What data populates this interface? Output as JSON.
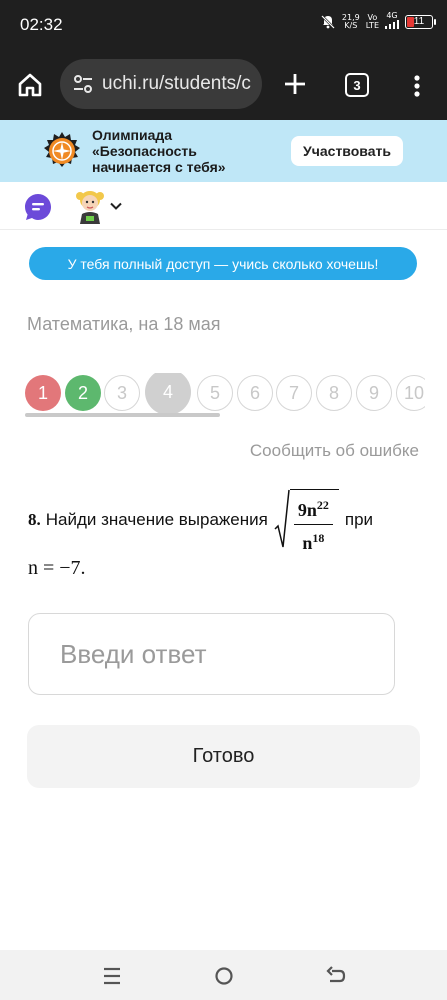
{
  "status_bar": {
    "time": "02:32",
    "net_speed_top": "21,9",
    "net_speed_bottom": "K/S",
    "volte_top": "Vo",
    "volte_bottom": "LTE",
    "signal_label": "4G",
    "battery": "11"
  },
  "browser": {
    "url": "uchi.ru/students/c",
    "tab_count": "3"
  },
  "promo": {
    "text": "Олимпиада «Безопасность начинается с тебя»",
    "button": "Участвовать"
  },
  "access_banner": "У тебя полный доступ — учись сколько хочешь!",
  "lesson_title": "Математика, на 18 мая",
  "progress": {
    "items": [
      {
        "label": "1",
        "state": "wrong"
      },
      {
        "label": "2",
        "state": "correct"
      },
      {
        "label": "3",
        "state": "pending"
      },
      {
        "label": "4",
        "state": "current"
      },
      {
        "label": "5",
        "state": "pending"
      },
      {
        "label": "6",
        "state": "pending"
      },
      {
        "label": "7",
        "state": "pending"
      },
      {
        "label": "8",
        "state": "pending"
      },
      {
        "label": "9",
        "state": "pending"
      },
      {
        "label": "10",
        "state": "pending"
      }
    ]
  },
  "report_link": "Сообщить об ошибке",
  "task": {
    "number": "8.",
    "text_before": "Найди значение выражения",
    "numerator_base": "9n",
    "numerator_exp": "22",
    "denominator_base": "n",
    "denominator_exp": "18",
    "text_after": "при",
    "condition": "n = −7."
  },
  "answer": {
    "placeholder": "Введи ответ",
    "value": ""
  },
  "done_button": "Готово",
  "colors": {
    "wrong": "#e2777a",
    "correct": "#5db86e",
    "accent": "#2aa9e8",
    "promo_bg": "#bfe7f7"
  }
}
